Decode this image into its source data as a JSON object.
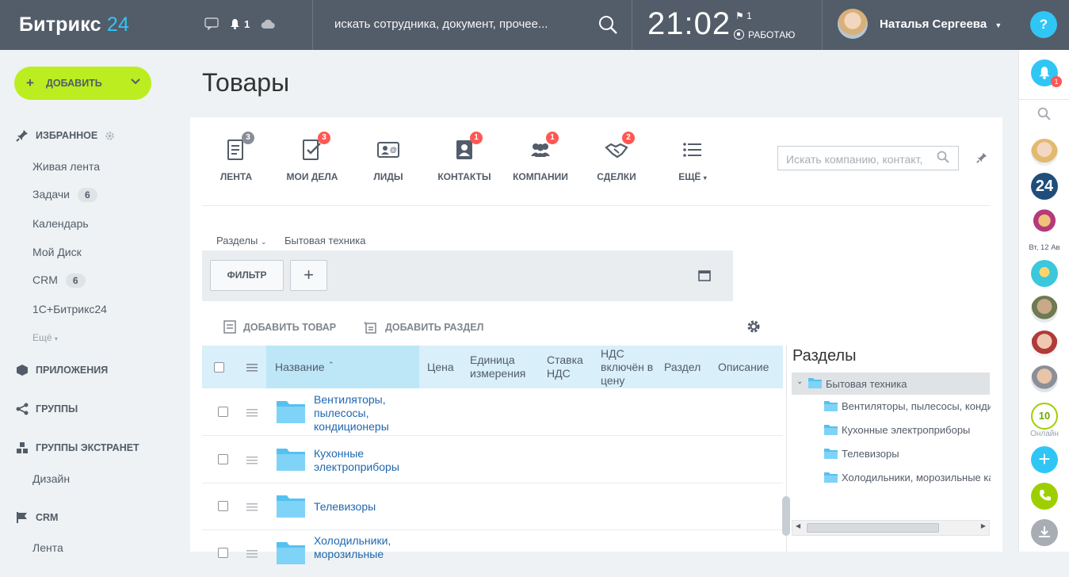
{
  "topbar": {
    "logo_main": "Битрикс",
    "logo_num": "24",
    "notif_count": "1",
    "search_placeholder": "искать сотрудника, документ, прочее...",
    "time": "21:02",
    "flag_count": "1",
    "work_status": "РАБОТАЮ",
    "user_name": "Наталья Сергеева",
    "help": "?"
  },
  "sidebar": {
    "add_button": "ДОБАВИТЬ",
    "favorites": "ИЗБРАННОЕ",
    "items": [
      {
        "label": "Живая лента"
      },
      {
        "label": "Задачи",
        "count": "6"
      },
      {
        "label": "Календарь"
      },
      {
        "label": "Мой Диск"
      },
      {
        "label": "CRM",
        "count": "6"
      },
      {
        "label": "1С+Битрикс24"
      }
    ],
    "more": "Ещё",
    "apps": "ПРИЛОЖЕНИЯ",
    "groups": "ГРУППЫ",
    "extranet": "ГРУППЫ ЭКСТРАНЕТ",
    "extranet_item": "Дизайн",
    "crm": "CRM",
    "crm_item": "Лента"
  },
  "page": {
    "title": "Товары"
  },
  "crm_menu": [
    {
      "label": "ЛЕНТА",
      "badge": "3"
    },
    {
      "label": "МОИ ДЕЛА",
      "badge": "3"
    },
    {
      "label": "ЛИДЫ",
      "badge": ""
    },
    {
      "label": "КОНТАКТЫ",
      "badge": "1"
    },
    {
      "label": "КОМПАНИИ",
      "badge": "1"
    },
    {
      "label": "СДЕЛКИ",
      "badge": "2"
    },
    {
      "label": "ЕЩЁ",
      "badge": ""
    }
  ],
  "crm_search_placeholder": "Искать компанию, контакт,",
  "breadcrumb": {
    "sections": "Разделы",
    "current": "Бытовая техника"
  },
  "filter": {
    "button": "ФИЛЬТР",
    "add": "+"
  },
  "actions": {
    "add_product": "ДОБАВИТЬ ТОВАР",
    "add_section": "ДОБАВИТЬ РАЗДЕЛ"
  },
  "grid": {
    "columns": [
      "Название",
      "Цена",
      "Единица измерения",
      "Ставка НДС",
      "НДС включён в цену",
      "Раздел",
      "Описание"
    ],
    "rows": [
      {
        "name": "Вентиляторы, пылесосы, кондиционеры"
      },
      {
        "name": "Кухонные электроприборы"
      },
      {
        "name": "Телевизоры"
      },
      {
        "name": "Холодильники, морозильные"
      }
    ]
  },
  "tree": {
    "title": "Разделы",
    "root": "Бытовая техника",
    "items": [
      "Вентиляторы, пылесосы, конди",
      "Кухонные электроприборы",
      "Телевизоры",
      "Холодильники, морозильные ка"
    ]
  },
  "rightbar": {
    "notif_badge": "1",
    "date_label": "Вт, 12 Ав",
    "online_count": "10",
    "online_label": "Онлайн"
  },
  "colors": {
    "topbar": "#535c69",
    "accent_green": "#bbed21",
    "accent_blue": "#2fc6f6",
    "badge_red": "#ff5752",
    "link": "#2067b0"
  }
}
